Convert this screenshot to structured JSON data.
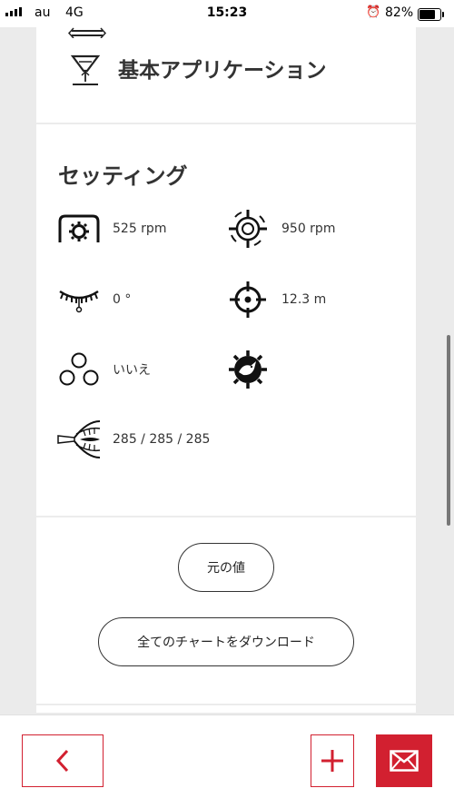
{
  "status_bar": {
    "carrier": "au",
    "network": "4G",
    "time": "15:23",
    "alarm_icon": "alarm-clock-icon",
    "battery": "82%"
  },
  "app": {
    "title": "基本アプリケーション",
    "icon": "fertilizer-spreader-icon"
  },
  "settings": {
    "title": "セッティング",
    "items": [
      {
        "icon": "pto-speed-icon",
        "value": "525 rpm"
      },
      {
        "icon": "disc-speed-icon",
        "value": "950 rpm"
      },
      {
        "icon": "vane-angle-icon",
        "value": "0 °"
      },
      {
        "icon": "target-icon",
        "value": "12.3 m"
      },
      {
        "icon": "granules-icon",
        "value": "いいえ"
      },
      {
        "icon": "bird-deflector-icon",
        "value": ""
      },
      {
        "icon": "spread-pattern-icon",
        "value": "285 / 285 / 285"
      }
    ]
  },
  "buttons": {
    "original_value": "元の値",
    "download_all_charts": "全てのチャートをダウンロード"
  },
  "bottom_bar": {
    "back": "chevron-left-icon",
    "add": "plus-icon",
    "mail": "envelope-icon",
    "accent_color": "#d22030"
  }
}
